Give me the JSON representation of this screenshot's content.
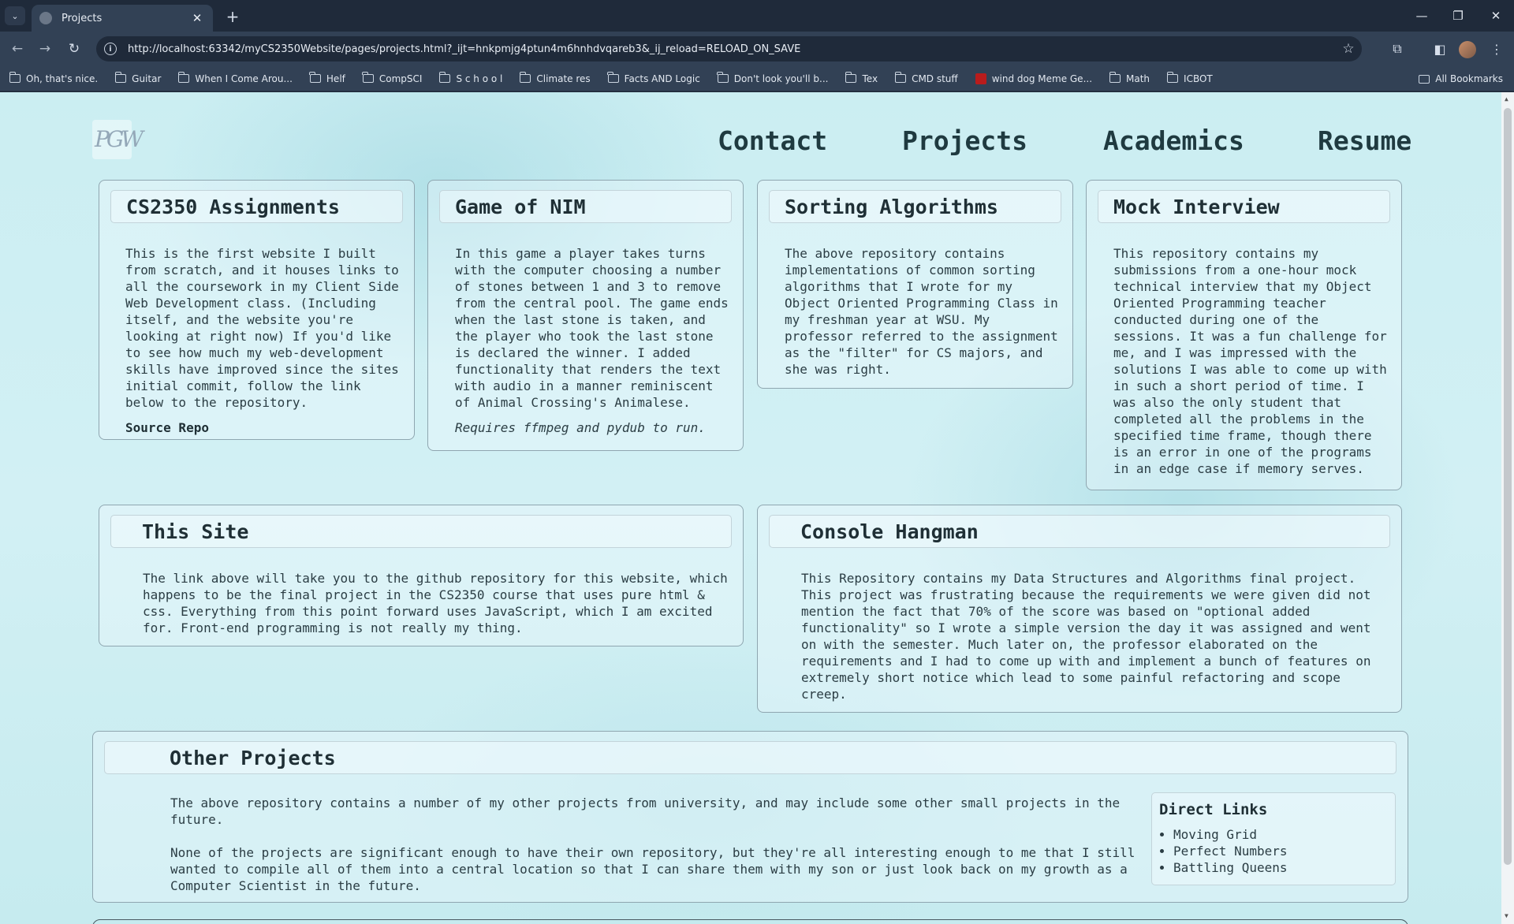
{
  "browser": {
    "tab_title": "Projects",
    "url": "http://localhost:63342/myCS2350Website/pages/projects.html?_ijt=hnkpmjg4ptun4m6hnhdvqareb3&_ij_reload=RELOAD_ON_SAVE",
    "bookmarks": [
      {
        "label": "Oh, that's nice.",
        "icon": "folder-icon"
      },
      {
        "label": "Guitar",
        "icon": "folder-icon"
      },
      {
        "label": "When I Come Arou...",
        "icon": "folder-icon"
      },
      {
        "label": "Helf",
        "icon": "folder-icon"
      },
      {
        "label": "CompSCI",
        "icon": "folder-icon"
      },
      {
        "label": "S c h o o l",
        "icon": "folder-icon"
      },
      {
        "label": "Climate res",
        "icon": "folder-icon"
      },
      {
        "label": "Facts AND Logic",
        "icon": "folder-icon"
      },
      {
        "label": "Don't look you'll b...",
        "icon": "folder-icon"
      },
      {
        "label": "Tex",
        "icon": "folder-icon"
      },
      {
        "label": "CMD stuff",
        "icon": "folder-icon"
      },
      {
        "label": "wind dog Meme Ge...",
        "icon": "meme-favicon"
      },
      {
        "label": "Math",
        "icon": "folder-icon"
      },
      {
        "label": "ICBOT",
        "icon": "folder-icon"
      }
    ],
    "all_bookmarks": "All Bookmarks"
  },
  "site": {
    "logo_text": "PGW",
    "nav": [
      "Contact",
      "Projects",
      "Academics",
      "Resume"
    ]
  },
  "cards": {
    "cs2350": {
      "title": "CS2350 Assignments",
      "body": "This is the first website I built\nfrom scratch, and it houses links to\nall the coursework in my Client Side\nWeb Development class. (Including\nitself, and the website you're\nlooking at right now) If you'd like\nto see how much my web-development\nskills have improved since the sites\ninitial commit, follow the link\nbelow to the repository.",
      "link": "Source Repo"
    },
    "nim": {
      "title": "Game of NIM",
      "body": "In this game a player takes turns\nwith the computer choosing a number\nof stones between 1 and 3 to remove\nfrom the central pool. The game ends\nwhen the last stone is taken, and\nthe player who took the last stone\nis declared the winner. I added\nfunctionality that renders the text\nwith audio in a manner reminiscent\nof Animal Crossing's Animalese.",
      "note": "Requires ffmpeg and pydub to run."
    },
    "sorting": {
      "title": "Sorting Algorithms",
      "body": "The above repository contains\nimplementations of common sorting\nalgorithms that I wrote for my\nObject Oriented Programming Class in\nmy freshman year at WSU. My\nprofessor referred to the assignment\nas the \"filter\" for CS majors, and\nshe was right."
    },
    "mock": {
      "title": "Mock Interview",
      "body": "This repository contains my\nsubmissions from a one-hour mock\ntechnical interview that my Object\nOriented Programming teacher\nconducted during one of the\nsessions. It was a fun challenge for\nme, and I was impressed with the\nsolutions I was able to come up with\nin such a short period of time. I\nwas also the only student that\ncompleted all the problems in the\nspecified time frame, though there\nis an error in one of the programs\nin an edge case if memory serves."
    },
    "site": {
      "title": "This Site",
      "body": "The link above will take you to the github repository for this website, which\nhappens to be the final project in the CS2350 course that uses pure html &\ncss. Everything from this point forward uses JavaScript, which I am excited\nfor. Front-end programming is not really my thing."
    },
    "hangman": {
      "title": "Console Hangman",
      "body": "This Repository contains my Data Structures and Algorithms final project.\nThis project was frustrating because the requirements we were given did not\nmention the fact that 70% of the score was based on \"optional added\nfunctionality\" so I wrote a simple version the day it was assigned and went\non with the semester. Much later on, the professor elaborated on the\nrequirements and I had to come up with and implement a bunch of features on\nextremely short notice which lead to some painful refactoring and scope\ncreep."
    },
    "other": {
      "title": "Other Projects",
      "para1": "The above repository contains a number of my other projects from university, and may include some other small projects in the\nfuture.",
      "para2": "None of the projects are significant enough to have their own repository, but they're all interesting enough to me that I still\nwanted to compile all of them into a central location so that I can share them with my son or just look back on my growth as a\nComputer Scientist in the future.",
      "links_title": "Direct Links",
      "links": [
        "Moving Grid",
        "Perfect Numbers",
        "Battling Queens"
      ]
    }
  }
}
